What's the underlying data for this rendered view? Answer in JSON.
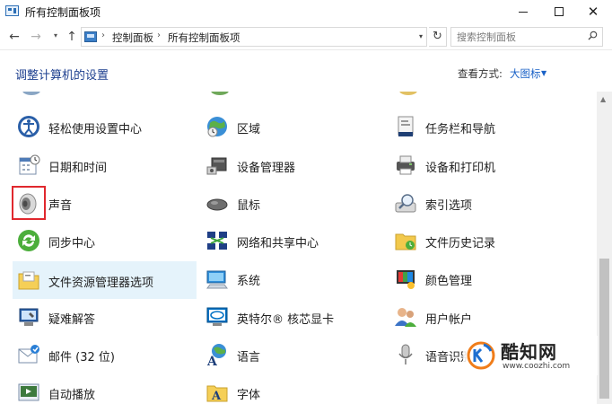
{
  "window": {
    "title": "所有控制面板项",
    "minimize_icon": "minimize-icon",
    "maximize_icon": "maximize-icon",
    "close_glyph": "✕"
  },
  "nav": {
    "back_glyph": "←",
    "forward_glyph": "→",
    "recent_glyph": "▾",
    "up_glyph": "↑",
    "breadcrumb": [
      "控制面板",
      "所有控制面板项"
    ],
    "breadcrumb_sep": "›",
    "dropdown_glyph": "▾",
    "refresh_glyph": "↻",
    "search_placeholder": "搜索控制面板"
  },
  "header": {
    "heading": "调整计算机的设置",
    "view_label": "查看方式:",
    "view_value": "大图标",
    "view_caret": "▼"
  },
  "items": [
    {
      "label": "轻松使用设置中心",
      "icon": "ease-of-access-icon"
    },
    {
      "label": "区域",
      "icon": "region-icon"
    },
    {
      "label": "任务栏和导航",
      "icon": "taskbar-icon"
    },
    {
      "label": "日期和时间",
      "icon": "calendar-clock-icon"
    },
    {
      "label": "设备管理器",
      "icon": "device-manager-icon"
    },
    {
      "label": "设备和打印机",
      "icon": "printer-icon"
    },
    {
      "label": "声音",
      "icon": "speaker-icon"
    },
    {
      "label": "鼠标",
      "icon": "mouse-icon"
    },
    {
      "label": "索引选项",
      "icon": "indexing-icon"
    },
    {
      "label": "同步中心",
      "icon": "sync-icon"
    },
    {
      "label": "网络和共享中心",
      "icon": "network-icon"
    },
    {
      "label": "文件历史记录",
      "icon": "file-history-icon"
    },
    {
      "label": "文件资源管理器选项",
      "icon": "folder-options-icon"
    },
    {
      "label": "系统",
      "icon": "system-icon"
    },
    {
      "label": "颜色管理",
      "icon": "color-management-icon"
    },
    {
      "label": "疑难解答",
      "icon": "troubleshooting-icon"
    },
    {
      "label": "英特尔® 核芯显卡",
      "icon": "intel-graphics-icon"
    },
    {
      "label": "用户帐户",
      "icon": "user-accounts-icon"
    },
    {
      "label": "邮件 (32 位)",
      "icon": "mail-icon"
    },
    {
      "label": "语言",
      "icon": "language-icon"
    },
    {
      "label": "语音识别",
      "icon": "microphone-icon"
    },
    {
      "label": "自动播放",
      "icon": "autoplay-icon"
    },
    {
      "label": "字体",
      "icon": "fonts-icon"
    }
  ],
  "selected_item": "文件资源管理器选项",
  "highlighted_item": "声音",
  "watermark": {
    "name": "酷知网",
    "url": "www.coozhi.com"
  },
  "colors": {
    "heading": "#1d3f8f",
    "link": "#1a62c7",
    "selection": "#e5f3fb",
    "highlight_box": "#e0282e"
  }
}
